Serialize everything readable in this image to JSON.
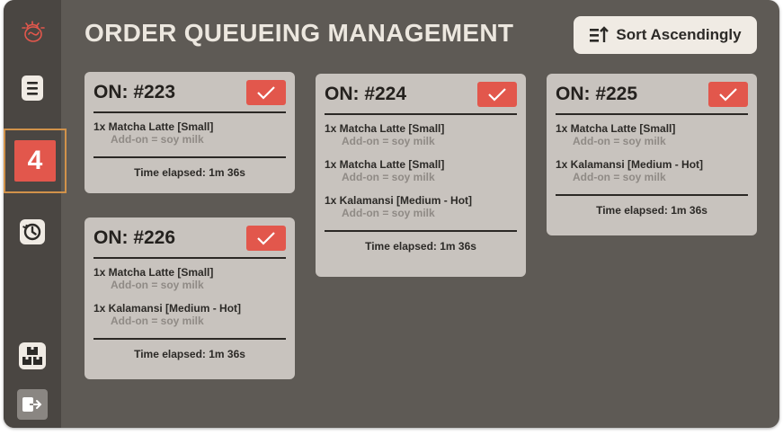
{
  "page": {
    "title": "ORDER QUEUEING MANAGEMENT"
  },
  "toolbar": {
    "sort_label": "Sort Ascendingly",
    "sort_icon": "sort-ascending-icon"
  },
  "sidebar": {
    "logo_icon": "logo-icon",
    "items": [
      {
        "id": "orders",
        "icon": "order-list-icon"
      },
      {
        "id": "queue",
        "badge": "4",
        "active": true
      },
      {
        "id": "history",
        "icon": "history-icon"
      },
      {
        "id": "inventory",
        "icon": "inventory-icon"
      },
      {
        "id": "logout",
        "icon": "logout-icon"
      }
    ]
  },
  "orders": [
    {
      "number": "ON: #223",
      "items": [
        {
          "name": "1x Matcha Latte [Small]",
          "addon": "Add-on = soy milk"
        }
      ],
      "elapsed": "Time elapsed: 1m 36s"
    },
    {
      "number": "ON: #224",
      "items": [
        {
          "name": "1x Matcha Latte [Small]",
          "addon": "Add-on = soy milk"
        },
        {
          "name": "1x Matcha Latte [Small]",
          "addon": "Add-on = soy milk"
        },
        {
          "name": "1x Kalamansi [Medium - Hot]",
          "addon": "Add-on = soy milk"
        }
      ],
      "elapsed": "Time elapsed: 1m 36s"
    },
    {
      "number": "ON: #225",
      "items": [
        {
          "name": "1x Matcha Latte [Small]",
          "addon": "Add-on = soy milk"
        },
        {
          "name": "1x Kalamansi [Medium - Hot]",
          "addon": "Add-on = soy milk"
        }
      ],
      "elapsed": "Time elapsed: 1m 36s"
    },
    {
      "number": "ON: #226",
      "items": [
        {
          "name": "1x Matcha Latte [Small]",
          "addon": "Add-on = soy milk"
        },
        {
          "name": "1x Kalamansi [Medium - Hot]",
          "addon": "Add-on = soy milk"
        }
      ],
      "elapsed": "Time elapsed: 1m 36s"
    }
  ],
  "colors": {
    "background": "#5e5a55",
    "sidebar": "#4a4642",
    "card": "#c8c3be",
    "accent": "#e2574c",
    "active_outline": "#d1924a"
  }
}
